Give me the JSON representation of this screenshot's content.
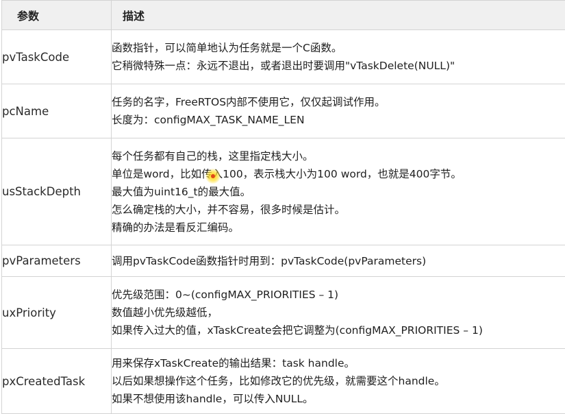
{
  "table": {
    "headers": [
      "参数",
      "描述"
    ],
    "rows": [
      {
        "name": "pvTaskCode",
        "lines": [
          "函数指针，可以简单地认为任务就是一个C函数。",
          "它稍微特殊一点：永远不退出，或者退出时要调用\"vTaskDelete(NULL)\""
        ]
      },
      {
        "name": "pcName",
        "lines": [
          "任务的名字，FreeRTOS内部不使用它，仅仅起调试作用。",
          "长度为：configMAX_TASK_NAME_LEN"
        ]
      },
      {
        "name": "usStackDepth",
        "lines": [
          "每个任务都有自己的栈，这里指定栈大小。",
          "单位是word，比如传入100，表示栈大小为100 word，也就是400字节。",
          "最大值为uint16_t的最大值。",
          "怎么确定栈的大小，并不容易，很多时候是估计。",
          "精确的办法是看反汇编码。"
        ]
      },
      {
        "name": "pvParameters",
        "lines": [
          "调用pvTaskCode函数指针时用到：pvTaskCode(pvParameters)"
        ]
      },
      {
        "name": "uxPriority",
        "lines": [
          "优先级范围：0~(configMAX_PRIORITIES – 1)",
          "数值越小优先级越低，",
          "如果传入过大的值，xTaskCreate会把它调整为(configMAX_PRIORITIES – 1)"
        ]
      },
      {
        "name": "pxCreatedTask",
        "lines": [
          "用来保存xTaskCreate的输出结果：task handle。",
          "以后如果想操作这个任务，比如修改它的优先级，就需要这个handle。",
          "如果不想使用该handle，可以传入NULL。"
        ]
      }
    ]
  }
}
